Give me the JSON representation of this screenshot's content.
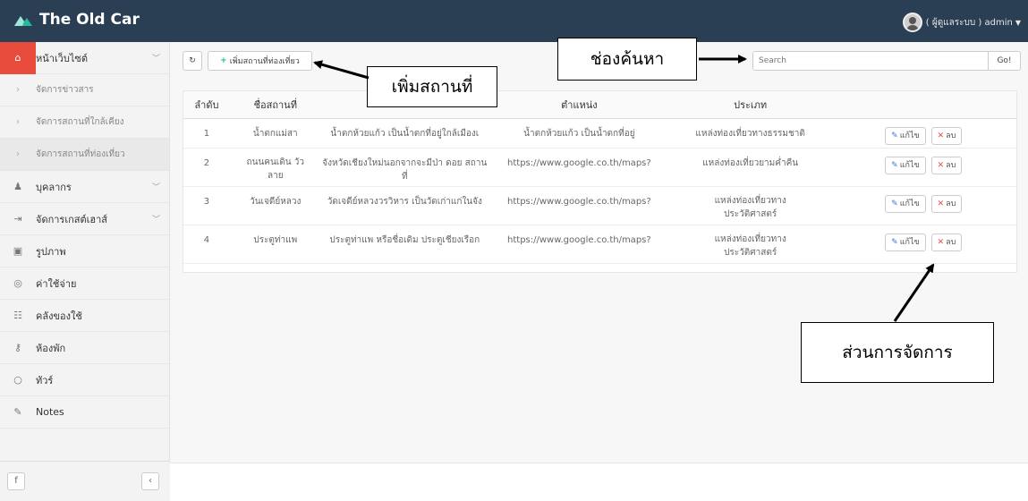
{
  "app": {
    "title": "The Old Car"
  },
  "user": {
    "label": "( ผู้ดูแลระบบ ) admin"
  },
  "sidebar": {
    "items": [
      {
        "icon": "home-icon",
        "glyph": "⌂",
        "label": "หน้าเว็บไซต์",
        "chevron": true
      },
      {
        "icon": "chevron-right-icon",
        "glyph": "›",
        "label": "จัดการข่าวสาร"
      },
      {
        "icon": "chevron-right-icon",
        "glyph": "›",
        "label": "จัดการสถานที่ใกล้เคียง"
      },
      {
        "icon": "chevron-right-icon",
        "glyph": "›",
        "label": "จัดการสถานที่ท่องเที่ยว"
      },
      {
        "icon": "users-icon",
        "glyph": "♟",
        "label": "บุคลากร",
        "chevron": true
      },
      {
        "icon": "sign-in-icon",
        "glyph": "⇥",
        "label": "จัดการเกสต์เฮาส์",
        "chevron": true
      },
      {
        "icon": "image-icon",
        "glyph": "▣",
        "label": "รูปภาพ"
      },
      {
        "icon": "money-icon",
        "glyph": "◎",
        "label": "ค่าใช้จ่าย"
      },
      {
        "icon": "cart-icon",
        "glyph": "☷",
        "label": "คลังของใช้"
      },
      {
        "icon": "key-icon",
        "glyph": "⚷",
        "label": "ห้องพัก"
      },
      {
        "icon": "map-marker-icon",
        "glyph": "○",
        "label": "ทัวร์"
      },
      {
        "icon": "pencil-icon",
        "glyph": "✎",
        "label": "Notes"
      }
    ],
    "footer": {
      "facebook": "f",
      "collapse": "‹"
    }
  },
  "toolbar": {
    "refresh_glyph": "↻",
    "add_label": "เพิ่มสถานที่ท่องเที่ยว",
    "add_glyph": "+"
  },
  "search": {
    "placeholder": "Search",
    "go_label": "Go!"
  },
  "table": {
    "headers": [
      "ลำดับ",
      "ชื่อสถานที่",
      "",
      "ตำแหน่ง",
      "ประเภท",
      ""
    ],
    "rows": [
      [
        "1",
        "น้ำตกแม่สา",
        "น้ำตกห้วยแก้ว เป็นน้ำตกที่อยู่ใกล้เมืองเ",
        "น้ำตกห้วยแก้ว เป็นน้ำตกที่อยู่",
        "แหล่งท่องเที่ยวทางธรรมชาติ"
      ],
      [
        "2",
        "ถนนคนเดิน วัวลาย",
        "จังหวัดเชียงใหม่นอกจากจะมีป่า ดอย สถานที่",
        "https://www.google.co.th/maps?",
        "แหล่งท่องเที่ยวยามค่ำคืน"
      ],
      [
        "3",
        "วันเจดีย์หลวง",
        "วัดเจดีย์หลวงวรวิหาร เป็นวัดเก่าแก่ในจัง",
        "https://www.google.co.th/maps?",
        "แหล่งท่องเที่ยวทางประวัติศาสตร์"
      ],
      [
        "4",
        "ประตูท่าแพ",
        "ประตูท่าแพ หรือชื่อเดิม ประตูเชียงเรือก",
        "https://www.google.co.th/maps?",
        "แหล่งท่องเที่ยวทางประวัติศาสตร์"
      ]
    ],
    "edit_label": "แก้ไข",
    "delete_label": "ลบ"
  },
  "annotations": {
    "add_place": "เพิ่มสถานที่",
    "search_box": "ช่องค้นหา",
    "management": "ส่วนการจัดการ"
  },
  "colors": {
    "topbar": "#2a3f54",
    "active": "#e74c3c",
    "accent": "#26b99a"
  }
}
